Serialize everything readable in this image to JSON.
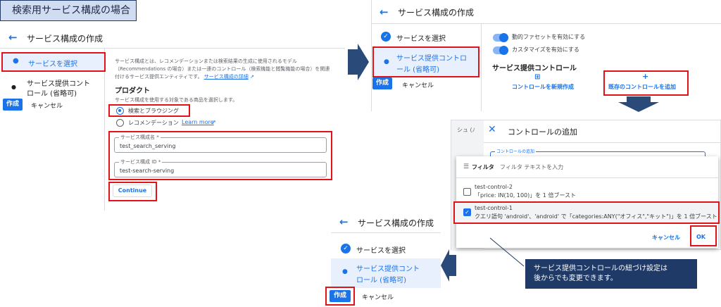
{
  "banner": "検索用サービス構成の場合",
  "panel1": {
    "title": "サービス構成の作成",
    "steps": [
      "サービスを選択",
      "サービス提供コント",
      "ロール (省略可)"
    ],
    "create": "作成",
    "cancel": "キャンセル",
    "intro_lines": [
      "サービス構成とは、レコメンデーションまたは検索結果の生成に使用されるモデル",
      "（Recommendations の場合）または一連のコントロール（検索機能と閲覧機能の場合）を関連",
      "付けるサービス提供エンティティです。"
    ],
    "intro_link": "サービス構成の詳細",
    "product_heading": "プロダクト",
    "product_desc": "サービス構成を使用する対象である商品を選択します。",
    "radio1": "検索とブラウジング",
    "radio2": "レコメンデーション",
    "learn_more": "Learn more",
    "field1_label": "サービス構成名 *",
    "field1_value": "test_search_serving",
    "field2_label": "サービス構成 ID *",
    "field2_value": "test-search-serving",
    "continue": "Continue"
  },
  "panel2": {
    "title": "サービス構成の作成",
    "step1": "サービスを選択",
    "step2a": "サービス提供コントロ",
    "step2b": "ール (省略可)",
    "create": "作成",
    "cancel": "キャンセル",
    "toggle1": "動的ファセットを有効にする",
    "toggle2": "カスタマイズを有効にする",
    "section": "サービス提供コントロール",
    "new_control": "コントロールを新規作成",
    "add_existing": "既存のコントロールを追加"
  },
  "panel3": {
    "peek": "シュ (ﾉ",
    "title": "コントロールの追加",
    "field_label": "コントロールの追加",
    "filter_label": "フィルタ",
    "filter_placeholder": "フィルタ テキストを入力",
    "items": [
      {
        "name": "test-control-2",
        "desc": "「price: IN(10, 100)」を 1 倍ブースト",
        "checked": false
      },
      {
        "name": "test-control-1",
        "desc": "クエリ語句 'android'、'android' で「categories:ANY(\"オフィス\",\"キット\")」を 1 倍ブースト",
        "checked": true
      }
    ],
    "cancel": "キャンセル",
    "ok": "OK"
  },
  "panel4": {
    "title": "サービス構成の作成",
    "step1": "サービスを選択",
    "step2a": "サービス提供コント",
    "step2b": "ロール (省略可)",
    "create": "作成",
    "cancel": "キャンセル"
  },
  "note": [
    "サービス提供コントロールの紐づけ設定は",
    "後からでも変更できます。"
  ],
  "colors": {
    "accent": "#1a73e8",
    "highlight": "#e0131b",
    "arrow": "#2a4a7a",
    "note_bg": "#1f3a66"
  }
}
